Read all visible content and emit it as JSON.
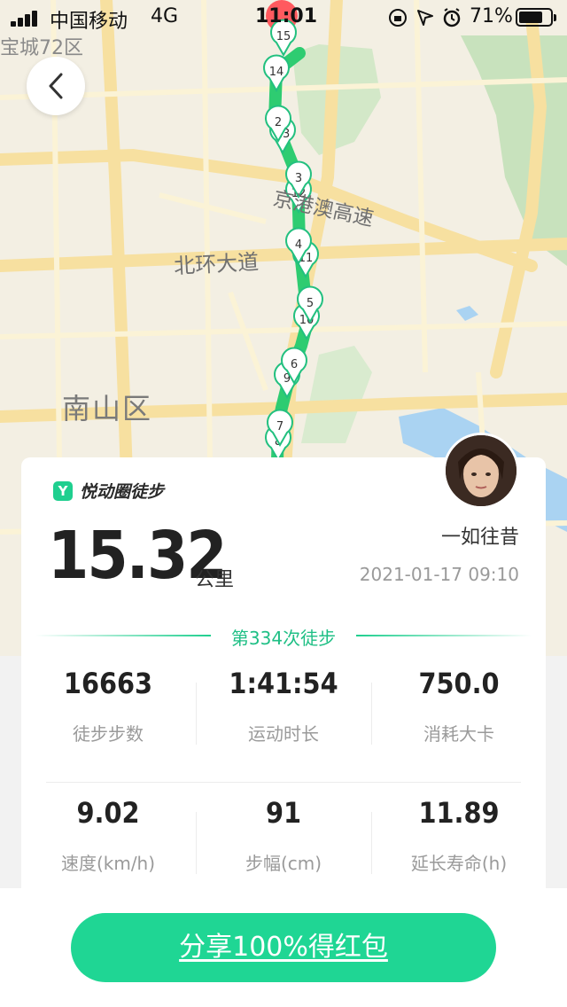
{
  "status_bar": {
    "carrier": "中国移动",
    "network": "4G",
    "time": "11:01",
    "battery_percent": "71%",
    "icons": [
      "lock-rotation-icon",
      "location-arrow-icon",
      "alarm-clock-icon"
    ]
  },
  "map": {
    "district_label": "南山区",
    "road_label": "北环大道",
    "highway_label": "京港澳高速",
    "zone_label": "宝城72区",
    "markers": [
      "15",
      "14",
      "13",
      "12",
      "11",
      "10",
      "9",
      "8",
      "3",
      "4",
      "5",
      "6",
      "7",
      "2"
    ],
    "route_color": "#2ecc71"
  },
  "card": {
    "brand": "悦动圈徒步",
    "brand_logo_letter": "Y",
    "distance": "15.32",
    "distance_unit": "公里",
    "username": "一如往昔",
    "datetime": "2021-01-17 09:10",
    "count_text": "第334次徒步",
    "stats_row1": [
      {
        "value": "16663",
        "label": "徒步步数"
      },
      {
        "value": "1:41:54",
        "label": "运动时长"
      },
      {
        "value": "750.0",
        "label": "消耗大卡"
      }
    ],
    "stats_row2": [
      {
        "value": "9.02",
        "label": "速度(km/h)"
      },
      {
        "value": "91",
        "label": "步幅(cm)"
      },
      {
        "value": "11.89",
        "label": "延长寿命(h)"
      }
    ]
  },
  "share_button": {
    "label": "分享100%得红包"
  },
  "colors": {
    "accent": "#1fd694",
    "text_dark": "#222222",
    "text_muted": "#9a9a9a"
  }
}
